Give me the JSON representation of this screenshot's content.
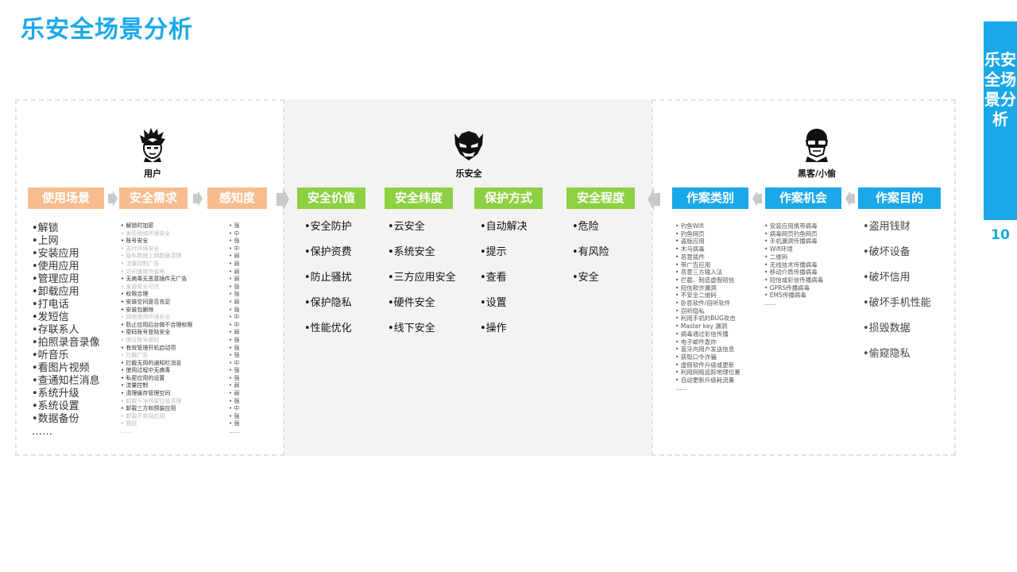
{
  "title": "乐安全场景分析",
  "side_tab": {
    "text": "乐安全场景分析",
    "page_number": "10"
  },
  "roles": {
    "user": "用户",
    "lesafe": "乐安全",
    "hacker": "黑客/小偷"
  },
  "headers": {
    "usage": "使用场景",
    "need": "安全需求",
    "sense": "感知度",
    "value": "安全价值",
    "dimension": "安全纬度",
    "protect": "保护方式",
    "degree": "安全程度",
    "type": "作案类别",
    "chance": "作案机会",
    "purpose": "作案目的"
  },
  "usage_items": [
    "•解锁",
    "•上网",
    "•安装应用",
    "•使用应用",
    "•管理应用",
    "•卸载应用",
    "•打电话",
    "•发短信",
    "•存联系人",
    "•拍照录音录像",
    "•听音乐",
    "•看图片视频",
    "•查通知栏消息",
    "•系统升级",
    "•系统设置",
    "•数据备份",
    "……"
  ],
  "need_items": [
    {
      "t": "•  解锁时加密",
      "dim": false
    },
    {
      "t": "•  发现网络环境安全",
      "dim": true
    },
    {
      "t": "•  账号安全",
      "dim": false
    },
    {
      "t": "•  支付环境安全",
      "dim": true
    },
    {
      "t": "•  隐私数据上网数据清理",
      "dim": true
    },
    {
      "t": "•  流量控制广告",
      "dim": true
    },
    {
      "t": "•  访问速度快省电",
      "dim": true
    },
    {
      "t": "•  无病毒无恶意插件无广告",
      "dim": false
    },
    {
      "t": "•  来源安全可信",
      "dim": true
    },
    {
      "t": "•  权限合理",
      "dim": false
    },
    {
      "t": "•  安装空间是否充足",
      "dim": false
    },
    {
      "t": "•  安装包删除",
      "dim": false
    },
    {
      "t": "•  网络使用环境安全",
      "dim": true
    },
    {
      "t": "•  防止应用后台做不合理权限",
      "dim": false
    },
    {
      "t": "•  密码账号登陆安全",
      "dim": false
    },
    {
      "t": "•  保证账号密码",
      "dim": true
    },
    {
      "t": "•  有效管理开机启动项",
      "dim": false
    },
    {
      "t": "•  拦截广告",
      "dim": true
    },
    {
      "t": "•  拦截无用的通知栏消息",
      "dim": false
    },
    {
      "t": "•  使用过程中无病毒",
      "dim": false
    },
    {
      "t": "•  私密应用的设置",
      "dim": false
    },
    {
      "t": "•  流量控制",
      "dim": false
    },
    {
      "t": "•  清理缓存管理空间",
      "dim": false
    },
    {
      "t": "•  卸载干净残留垃圾清理",
      "dim": true
    },
    {
      "t": "•  卸载三方和预装应用",
      "dim": false
    },
    {
      "t": "•  卸载不常用应用",
      "dim": true
    },
    {
      "t": "•  骚扰",
      "dim": true
    },
    {
      "t": "   ……",
      "dim": true
    }
  ],
  "sense_items": [
    "•  强",
    "•  中",
    "•  强",
    "•  中",
    "•  弱",
    "•  弱",
    "•  弱",
    "•  弱",
    "•  强",
    "•  强",
    "•  弱",
    "•  强",
    "•  中",
    "•  中",
    "•  弱",
    "•  强",
    "•  强",
    "•  强",
    "•  中",
    "•  强",
    "•  强",
    "•  弱",
    "•  弱",
    "•  强",
    "•  中",
    "•  强",
    "•  强",
    "  ……"
  ],
  "value_items": [
    "•安全防护",
    "•保护资费",
    "•防止骚扰",
    "•保护隐私",
    "•性能优化"
  ],
  "dimension_items": [
    "•云安全",
    "•系统安全",
    "•三方应用安全",
    "•硬件安全",
    "•线下安全"
  ],
  "protect_items": [
    "•自动解决",
    "•提示",
    "•查看",
    "•设置",
    "•操作"
  ],
  "degree_items": [
    "•危险",
    "•有风险",
    "•安全"
  ],
  "type_items": [
    "•  钓鱼Wifi",
    "•  钓鱼网页",
    "•  盗版应用",
    "•  木马病毒",
    "•  恶意插件",
    "•  带广告应用",
    "•  恶意三方输入法",
    "•  拦截、制造虚假短信",
    "•  短信欺诈漏洞",
    "•  不安全二维码",
    "•  卧底软件/窃听软件",
    "•  窃听隐私",
    "•  利用手机的BUG攻击",
    "•  Master key 漏洞",
    "•  病毒通过彩信传播",
    "•  电子邮件轰炸",
    "•  蓝牙向用户发送信息",
    "•  获取口令诈骗",
    "•  虚假软件升级或更新",
    "•  利用网络追踪地理位置",
    "•  自动更新升级耗流量",
    "   ……"
  ],
  "chance_items": [
    "•  安装应用携带病毒",
    "•  病毒网页钓鱼网页",
    "•  手机漏洞传播病毒",
    "•  Wifi环境",
    "•  二维码",
    "•  无线技术传播病毒",
    "•  移动介质传播病毒",
    "•  短信或彩信传播病毒",
    "•  GPRS传播病毒",
    "•  EMS传播病毒",
    "   ……"
  ],
  "purpose_items": [
    "•盗用钱财",
    "•破坏设备",
    "•破坏信用",
    "•破坏手机性能",
    "•损毁数据",
    "•偷窥隐私"
  ]
}
